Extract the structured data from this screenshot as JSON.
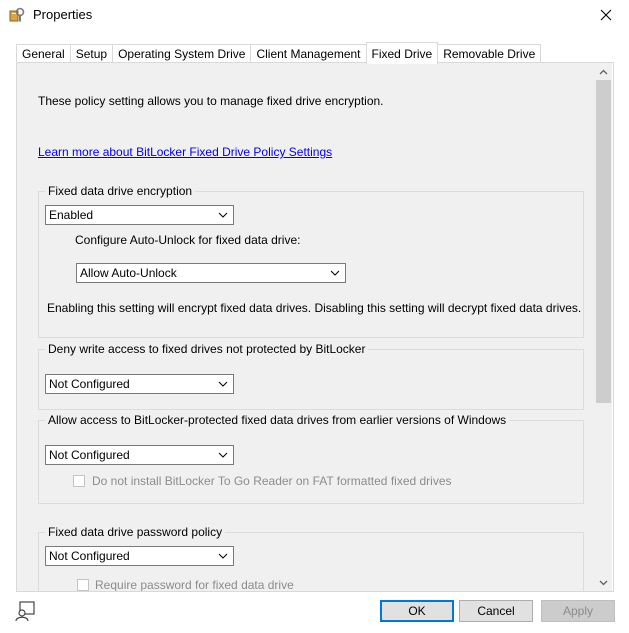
{
  "window": {
    "title": "Properties"
  },
  "tabs": [
    {
      "label": "General"
    },
    {
      "label": "Setup"
    },
    {
      "label": "Operating System Drive"
    },
    {
      "label": "Client Management"
    },
    {
      "label": "Fixed Drive"
    },
    {
      "label": "Removable Drive"
    }
  ],
  "active_tab": "Fixed Drive",
  "content": {
    "intro": "These policy setting allows you to manage fixed drive encryption.",
    "learn_more_link": "Learn more about BitLocker Fixed Drive Policy Settings",
    "encryption_group": {
      "title": "Fixed data drive encryption",
      "select_value": "Enabled",
      "auto_unlock_label": "Configure Auto-Unlock for fixed data drive:",
      "auto_unlock_value": "Allow Auto-Unlock",
      "note": "Enabling this setting will encrypt fixed data drives. Disabling this setting will decrypt fixed data drives."
    },
    "deny_write_group": {
      "title": "Deny write access to fixed drives not protected by BitLocker",
      "select_value": "Not Configured"
    },
    "earlier_versions_group": {
      "title": "Allow access to BitLocker-protected fixed data drives from earlier versions of Windows",
      "select_value": "Not Configured",
      "checkbox_label": "Do not install BitLocker To Go Reader on FAT formatted fixed drives",
      "checkbox_checked": false
    },
    "password_group": {
      "title": "Fixed data drive password policy",
      "select_value": "Not Configured",
      "checkbox_label": "Require password for fixed data drive",
      "checkbox_checked": false
    }
  },
  "footer": {
    "ok_label": "OK",
    "cancel_label": "Cancel",
    "apply_label": "Apply"
  },
  "colors": {
    "accent": "#0078d7",
    "link": "#0000ee",
    "panel_bg": "#f0f0f0"
  }
}
